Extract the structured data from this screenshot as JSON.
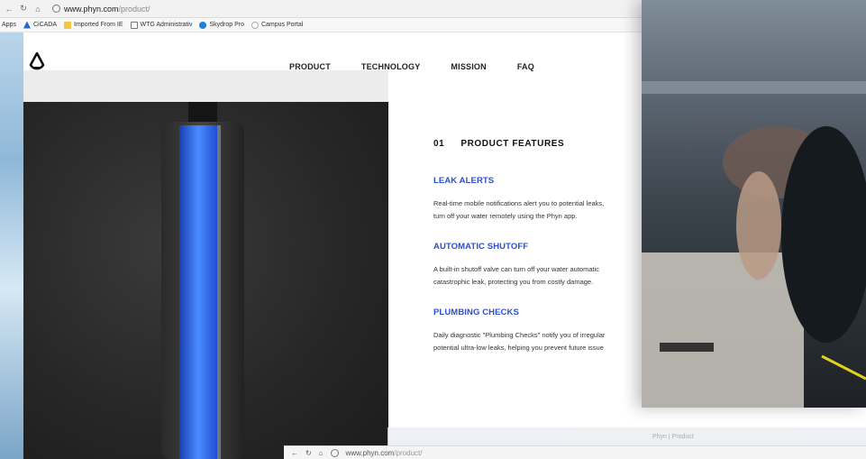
{
  "browser": {
    "url_host": "www.phyn.com",
    "url_path": "/product/",
    "bookmarks": [
      {
        "label": "Apps",
        "icon": "apps-icon"
      },
      {
        "label": "CiCADA",
        "icon": "cicada-icon"
      },
      {
        "label": "Imported From IE",
        "icon": "folder-icon"
      },
      {
        "label": "WTG Administrativ",
        "icon": "document-icon"
      },
      {
        "label": "Skydrop Pro",
        "icon": "skydrop-icon"
      },
      {
        "label": "Campus Portal",
        "icon": "campus-portal-icon"
      }
    ]
  },
  "site": {
    "nav": [
      "PRODUCT",
      "TECHNOLOGY",
      "MISSION",
      "FAQ"
    ],
    "section_number": "01",
    "section_title": "PRODUCT FEATURES",
    "features": [
      {
        "title": "LEAK ALERTS",
        "desc_line1": "Real-time mobile notifications alert you to potential leaks,",
        "desc_line2": "turn off your water remotely using the Phyn app."
      },
      {
        "title": "AUTOMATIC SHUTOFF",
        "desc_line1": "A built-in shutoff valve can turn off your water automatic",
        "desc_line2": "catastrophic leak, protecting you from costly damage."
      },
      {
        "title": "PLUMBING CHECKS",
        "desc_line1": "Daily diagnostic \"Plumbing Checks\" notify you of irregular",
        "desc_line2": "potential ultra-low leaks, helping you prevent future issue"
      }
    ]
  },
  "bottom_browser": {
    "url_host": "www.phyn.com",
    "url_path": "/product/",
    "tabs": [
      "Phyn | Product"
    ]
  },
  "colors": {
    "accent_blue": "#2b4fd0",
    "panel_dark": "#262626",
    "device_glow": "#2f6fe0"
  }
}
